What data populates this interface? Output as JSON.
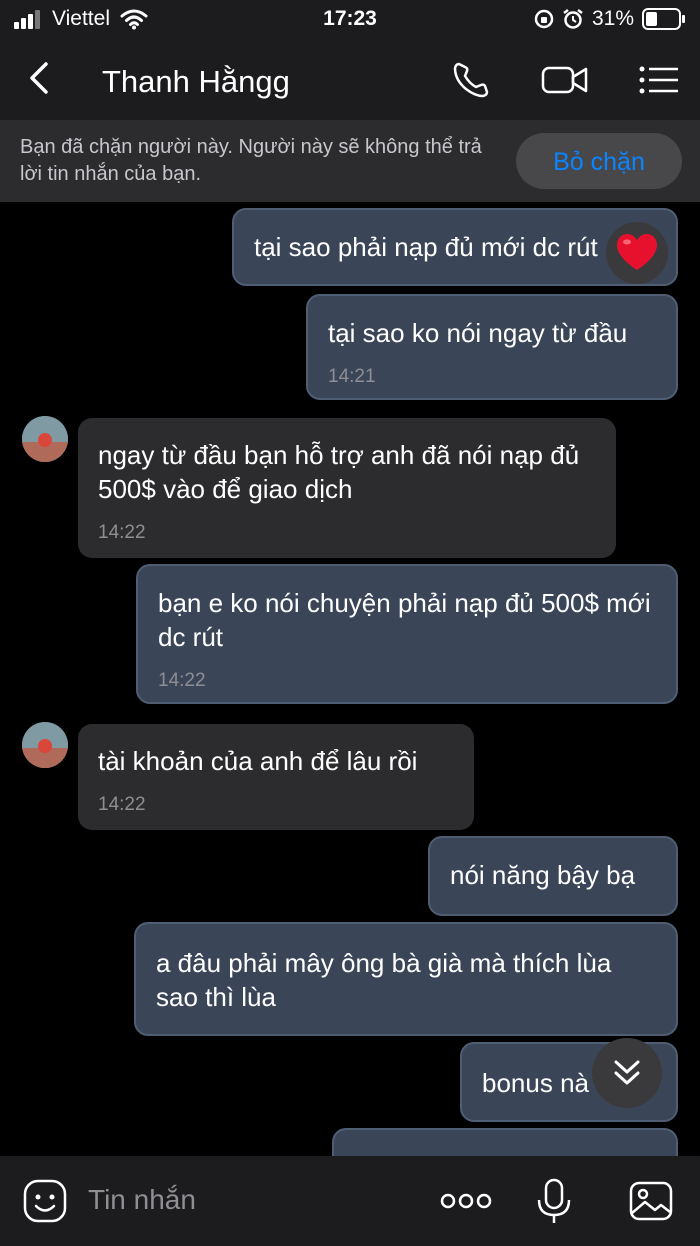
{
  "status_bar": {
    "carrier": "Viettel",
    "time": "17:23",
    "battery": "31%"
  },
  "header": {
    "title": "Thanh Hằngg"
  },
  "banner": {
    "text": "Bạn đã chặn người này. Người này sẽ không thể trả lời tin nhắn của bạn.",
    "unblock_label": "Bỏ chặn"
  },
  "messages": [
    {
      "dir": "out",
      "text": "tại sao phải nạp đủ mới dc rút",
      "time": ""
    },
    {
      "dir": "out",
      "text": "tại sao ko nói ngay từ đầu",
      "time": "14:21"
    },
    {
      "dir": "in",
      "text": "ngay từ đầu bạn hỗ trợ anh đã nói nạp đủ 500$ vào để giao dịch",
      "time": "14:22"
    },
    {
      "dir": "out",
      "text": "bạn e ko nói chuyện phải nạp đủ 500$ mới dc rút",
      "time": "14:22"
    },
    {
      "dir": "in",
      "text": "tài khoản của anh để lâu rồi",
      "time": "14:22"
    },
    {
      "dir": "out",
      "text": "nói năng bậy bạ",
      "time": ""
    },
    {
      "dir": "out",
      "text": "a đâu phải mây ông bà già mà thích lùa sao thì lùa",
      "time": ""
    },
    {
      "dir": "out",
      "text": "bonus nà",
      "time": ""
    }
  ],
  "input": {
    "placeholder": "Tin nhắn"
  },
  "icons": {
    "back": "chevron-left-icon",
    "call": "phone-icon",
    "video": "video-camera-icon",
    "menu": "list-menu-icon",
    "reaction": "heart-icon",
    "scroll": "double-chevron-down-icon",
    "emoji": "sticker-icon",
    "more": "more-dots-icon",
    "mic": "microphone-icon",
    "image": "image-icon"
  },
  "colors": {
    "accent": "#0a84ff",
    "outgoing_bubble": "#3a4657",
    "incoming_bubble": "#2c2c2e",
    "heart": "#e8112d"
  }
}
